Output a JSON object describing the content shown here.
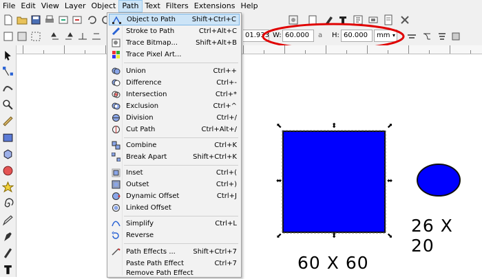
{
  "menubar": {
    "items": [
      "File",
      "Edit",
      "View",
      "Layer",
      "Object",
      "Path",
      "Text",
      "Filters",
      "Extensions",
      "Help"
    ]
  },
  "toolbar": {
    "x_value": "01.933",
    "w_label": "W:",
    "w_value": "60.000",
    "h_label": "H:",
    "h_value": "60.000",
    "unit": "mm",
    "lock": "a"
  },
  "path_menu": {
    "items": [
      {
        "label": "Object to Path",
        "shortcut": "Shift+Ctrl+C",
        "icon": "object-to-path-icon"
      },
      {
        "label": "Stroke to Path",
        "shortcut": "Ctrl+Alt+C",
        "icon": "stroke-to-path-icon"
      },
      {
        "label": "Trace Bitmap...",
        "shortcut": "Shift+Alt+B",
        "icon": "trace-bitmap-icon"
      },
      {
        "label": "Trace Pixel Art...",
        "shortcut": "",
        "icon": "trace-pixel-art-icon"
      },
      {
        "label": "Union",
        "shortcut": "Ctrl++",
        "icon": "union-icon"
      },
      {
        "label": "Difference",
        "shortcut": "Ctrl+-",
        "icon": "difference-icon"
      },
      {
        "label": "Intersection",
        "shortcut": "Ctrl+*",
        "icon": "intersection-icon"
      },
      {
        "label": "Exclusion",
        "shortcut": "Ctrl+^",
        "icon": "exclusion-icon"
      },
      {
        "label": "Division",
        "shortcut": "Ctrl+/",
        "icon": "division-icon"
      },
      {
        "label": "Cut Path",
        "shortcut": "Ctrl+Alt+/",
        "icon": "cut-path-icon"
      },
      {
        "label": "Combine",
        "shortcut": "Ctrl+K",
        "icon": "combine-icon"
      },
      {
        "label": "Break Apart",
        "shortcut": "Shift+Ctrl+K",
        "icon": "break-apart-icon"
      },
      {
        "label": "Inset",
        "shortcut": "Ctrl+(",
        "icon": "inset-icon"
      },
      {
        "label": "Outset",
        "shortcut": "Ctrl+)",
        "icon": "outset-icon"
      },
      {
        "label": "Dynamic Offset",
        "shortcut": "Ctrl+J",
        "icon": "dynamic-offset-icon"
      },
      {
        "label": "Linked Offset",
        "shortcut": "",
        "icon": "linked-offset-icon"
      },
      {
        "label": "Simplify",
        "shortcut": "Ctrl+L",
        "icon": "simplify-icon"
      },
      {
        "label": "Reverse",
        "shortcut": "",
        "icon": "reverse-icon"
      },
      {
        "label": "Path Effects ...",
        "shortcut": "Shift+Ctrl+7",
        "icon": "path-effects-icon"
      },
      {
        "label": "Paste Path Effect",
        "shortcut": "Ctrl+7",
        "icon": ""
      },
      {
        "label": "Remove Path Effect",
        "shortcut": "",
        "icon": ""
      }
    ]
  },
  "canvas": {
    "square_label": "60 X 60",
    "ellipse_label": "26 X 20",
    "fill_color": "#0000ff",
    "annotation_color": "#e00000"
  }
}
